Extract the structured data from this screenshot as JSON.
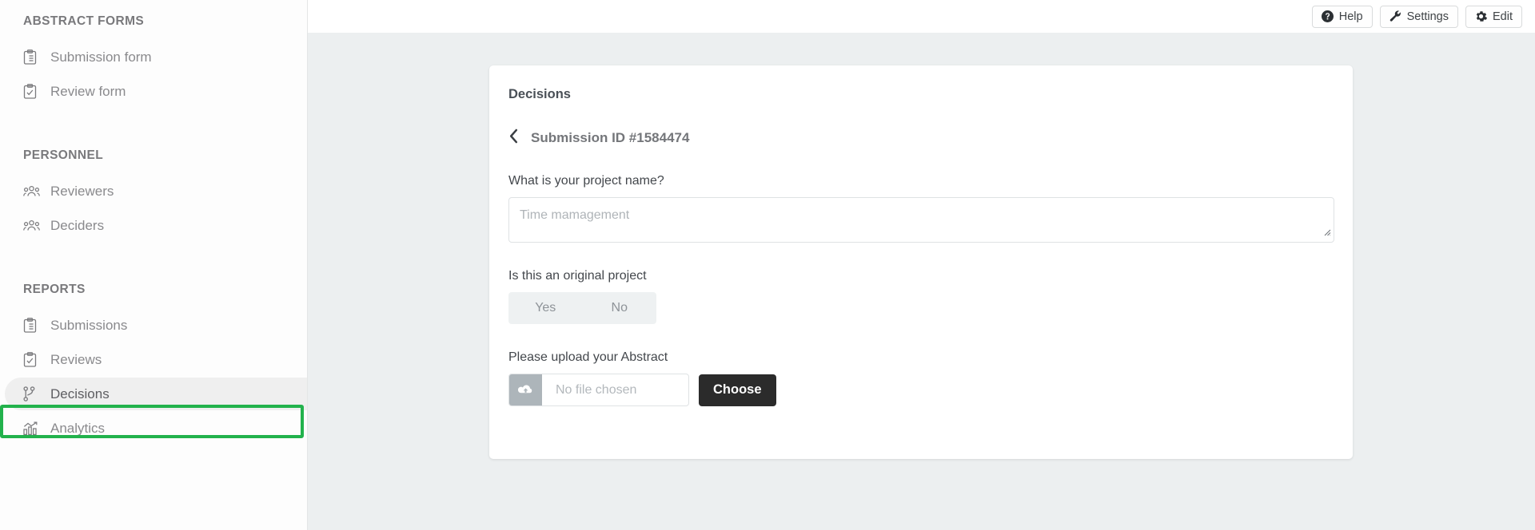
{
  "sidebar": {
    "sections": [
      {
        "title": "ABSTRACT FORMS",
        "items": [
          {
            "label": "Submission form",
            "icon": "clipboard-list-icon"
          },
          {
            "label": "Review form",
            "icon": "clipboard-check-icon"
          }
        ]
      },
      {
        "title": "PERSONNEL",
        "items": [
          {
            "label": "Reviewers",
            "icon": "users-icon"
          },
          {
            "label": "Deciders",
            "icon": "users-icon"
          }
        ]
      },
      {
        "title": "REPORTS",
        "items": [
          {
            "label": "Submissions",
            "icon": "clipboard-list-icon"
          },
          {
            "label": "Reviews",
            "icon": "clipboard-check-icon"
          },
          {
            "label": "Decisions",
            "icon": "git-branch-icon"
          },
          {
            "label": "Analytics",
            "icon": "bar-chart-icon"
          }
        ]
      }
    ],
    "active_item": "Decisions",
    "highlight_color": "#22b24c"
  },
  "toolbar": {
    "help_label": "Help",
    "settings_label": "Settings",
    "edit_label": "Edit"
  },
  "card": {
    "title": "Decisions",
    "submission_id": "Submission ID #1584474",
    "fields": {
      "project_name": {
        "label": "What is your project name?",
        "placeholder": "Time mamagement",
        "value": ""
      },
      "original_project": {
        "label": "Is this an original project",
        "options": [
          "Yes",
          "No"
        ],
        "selected": ""
      },
      "abstract_upload": {
        "label": "Please upload your Abstract",
        "placeholder": "No file chosen",
        "button_label": "Choose"
      }
    }
  }
}
